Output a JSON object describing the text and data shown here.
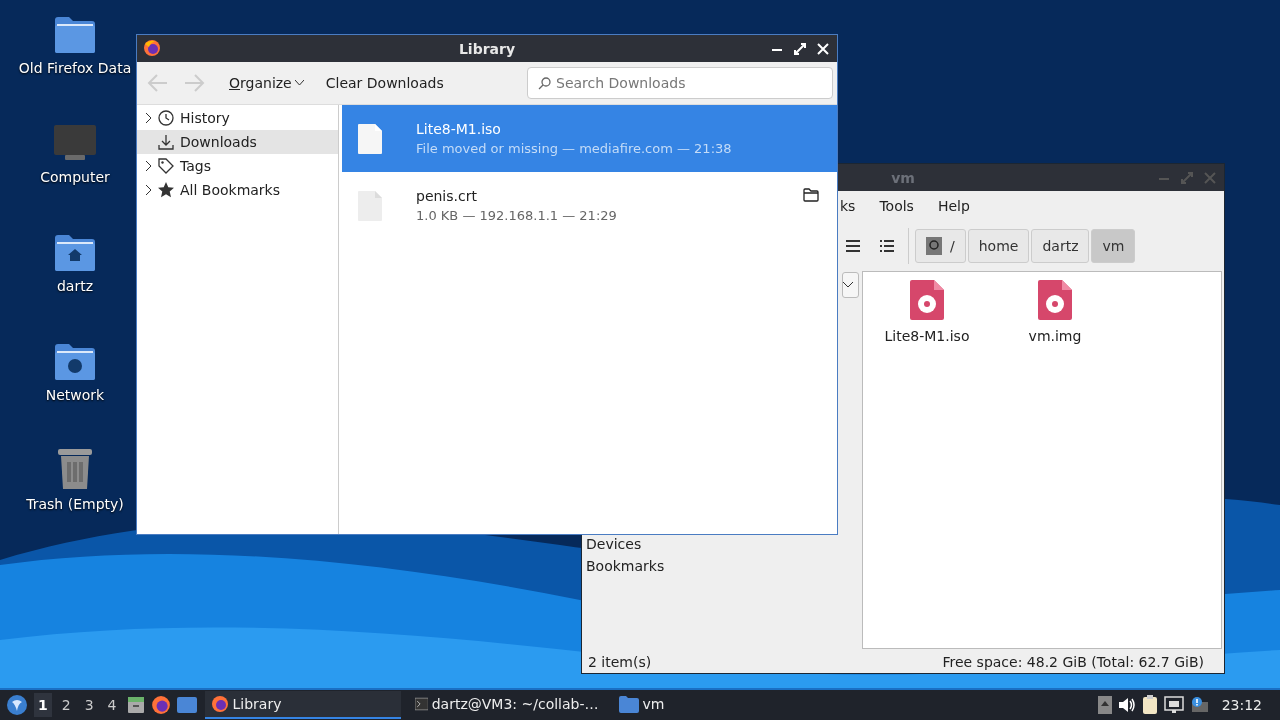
{
  "desktop_icons": [
    {
      "label": "Old Firefox Data",
      "kind": "folder"
    },
    {
      "label": "Computer",
      "kind": "computer"
    },
    {
      "label": "dartz",
      "kind": "home"
    },
    {
      "label": "Network",
      "kind": "network"
    },
    {
      "label": "Trash (Empty)",
      "kind": "trash"
    }
  ],
  "library_window": {
    "title": "Library",
    "organize": "Organize",
    "clear": "Clear Downloads",
    "search": {
      "placeholder": "Search Downloads"
    },
    "sidebar": [
      {
        "label": "History",
        "kind": "history",
        "expandable": true,
        "selected": false
      },
      {
        "label": "Downloads",
        "kind": "downloads",
        "expandable": false,
        "selected": true
      },
      {
        "label": "Tags",
        "kind": "tags",
        "expandable": true,
        "selected": false
      },
      {
        "label": "All Bookmarks",
        "kind": "bookmarks",
        "expandable": true,
        "selected": false
      }
    ],
    "downloads": [
      {
        "name": "Lite8-M1.iso",
        "detail": "File moved or missing — mediafire.com — 21:38",
        "selected": true,
        "kind": "missing"
      },
      {
        "name": "penis.crt",
        "detail": "1.0 KB — 192.168.1.1 — 21:29",
        "selected": false,
        "kind": "done"
      }
    ]
  },
  "file_window": {
    "title": "vm",
    "menu": [
      "ks",
      "Tools",
      "Help"
    ],
    "path": [
      {
        "label": "/",
        "kind": "root",
        "selected": false
      },
      {
        "label": "home",
        "kind": "dir",
        "selected": false
      },
      {
        "label": "dartz",
        "kind": "dir",
        "selected": false
      },
      {
        "label": "vm",
        "kind": "dir",
        "selected": true
      }
    ],
    "side_pane": [
      "Devices",
      "Bookmarks"
    ],
    "files": [
      {
        "name": "Lite8-M1.iso"
      },
      {
        "name": "vm.img"
      }
    ],
    "status_left": "2 item(s)",
    "status_right": "Free space: 48.2 GiB (Total: 62.7 GiB)"
  },
  "taskbar": {
    "workspaces": [
      {
        "label": "1",
        "selected": true
      },
      {
        "label": "2",
        "selected": false
      },
      {
        "label": "3",
        "selected": false
      },
      {
        "label": "4",
        "selected": false
      }
    ],
    "tasks": [
      {
        "label": "Library",
        "kind": "firefox",
        "selected": true
      },
      {
        "label": "dartz@VM3: ~/collab-…",
        "kind": "terminal",
        "selected": false
      },
      {
        "label": "vm",
        "kind": "folder",
        "selected": false
      }
    ],
    "clock": "23:12"
  }
}
